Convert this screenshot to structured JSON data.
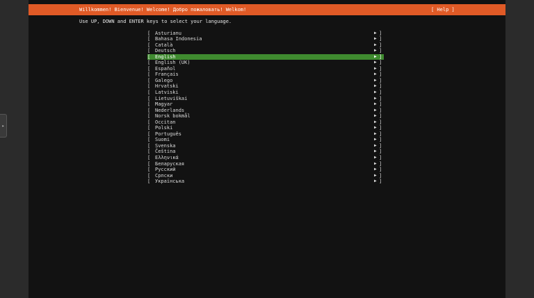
{
  "header": {
    "title": "Willkommen! Bienvenue! Welcome! Добро пожаловать! Welkom!",
    "help_label": "[ Help ]"
  },
  "instructions": "Use UP, DOWN and ENTER keys to select your language.",
  "languages": {
    "selected": "English",
    "items": [
      "Asturianu",
      "Bahasa Indonesia",
      "Català",
      "Deutsch",
      "English",
      "English (UK)",
      "Español",
      "Français",
      "Galego",
      "Hrvatski",
      "Latviski",
      "Lietuviškai",
      "Magyar",
      "Nederlands",
      "Norsk bokmål",
      "Occitan",
      "Polski",
      "Português",
      "Suomi",
      "Svenska",
      "Čeština",
      "Ελληνικά",
      "Беларуская",
      "Русский",
      "Српски",
      "Українська"
    ]
  },
  "glyphs": {
    "bracket_open": "[",
    "bracket_close": "]",
    "arrow": "▶",
    "side_tab_arrow": "▸"
  },
  "colors": {
    "header_bg": "#e05a26",
    "selected_bg": "#3f8b2f",
    "screen_bg": "#121212"
  }
}
